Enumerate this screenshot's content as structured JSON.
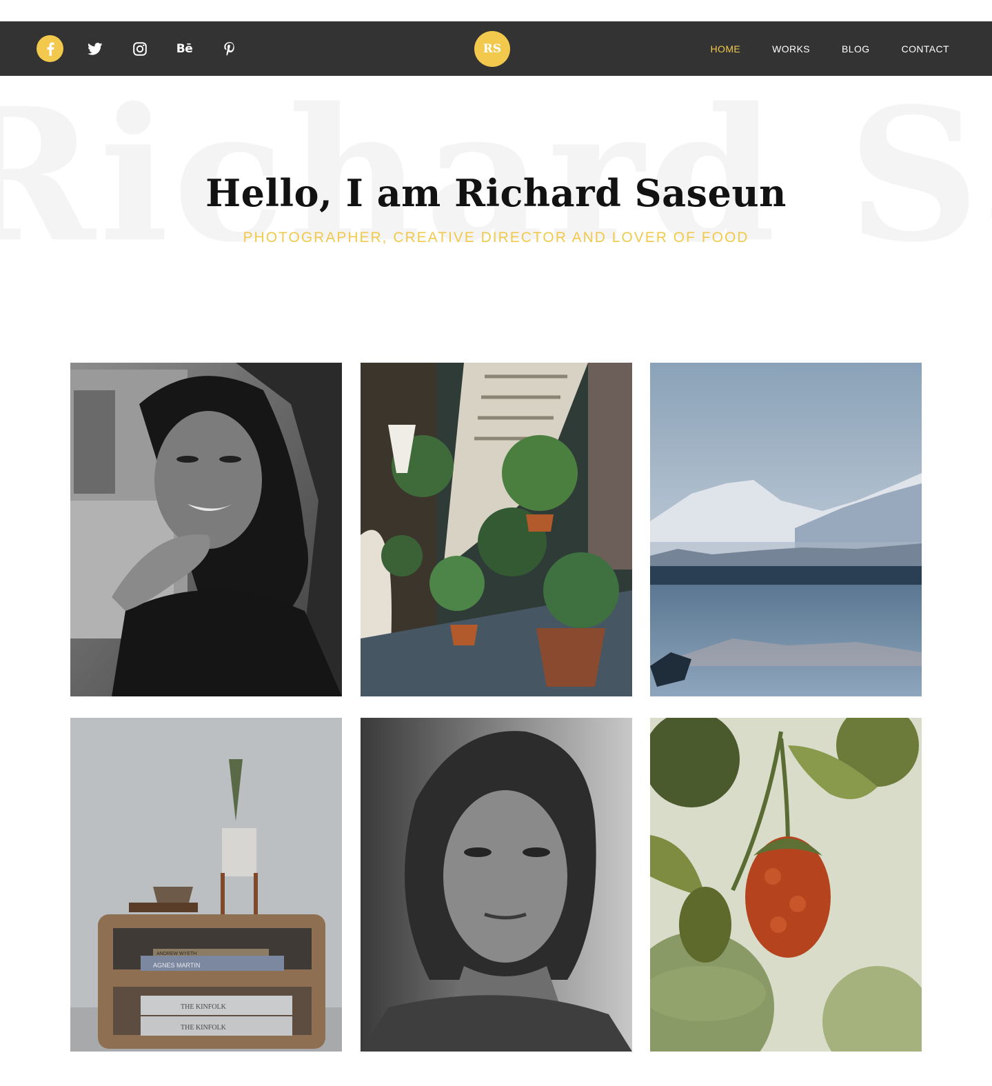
{
  "social": [
    {
      "name": "facebook-icon",
      "active": true
    },
    {
      "name": "twitter-icon",
      "active": false
    },
    {
      "name": "instagram-icon",
      "active": false
    },
    {
      "name": "behance-icon",
      "active": false,
      "glyph": "Bē"
    },
    {
      "name": "pinterest-icon",
      "active": false
    }
  ],
  "logo": {
    "text": "RS"
  },
  "nav": {
    "items": [
      {
        "label": "HOME",
        "active": true
      },
      {
        "label": "WORKS",
        "active": false
      },
      {
        "label": "BLOG",
        "active": false
      },
      {
        "label": "CONTACT",
        "active": false
      }
    ]
  },
  "hero": {
    "background_text": "Richard Saseun",
    "title": "Hello, I am Richard Saseun",
    "subtitle": "PHOTOGRAPHER, CREATIVE DIRECTOR AND LOVER OF FOOD"
  },
  "gallery": {
    "items": [
      {
        "subject": "black-and-white portrait of smiling woman"
      },
      {
        "subject": "spiral staircase with potted plants"
      },
      {
        "subject": "snowy mountains over a lake"
      },
      {
        "subject": "wooden shelf with books, bowl and cactus"
      },
      {
        "subject": "black-and-white portrait of freckled woman"
      },
      {
        "subject": "raspberry on a branch"
      }
    ],
    "book_labels": [
      "ANDREW WYETH",
      "AGNES MARTIN",
      "THE KINFOLK",
      "THE KINFOLK"
    ]
  },
  "colors": {
    "accent": "#f2c94c",
    "topbar": "#333333",
    "nav_text": "#ffffff",
    "title_text": "#121212",
    "background_name": "#f4f4f4"
  }
}
